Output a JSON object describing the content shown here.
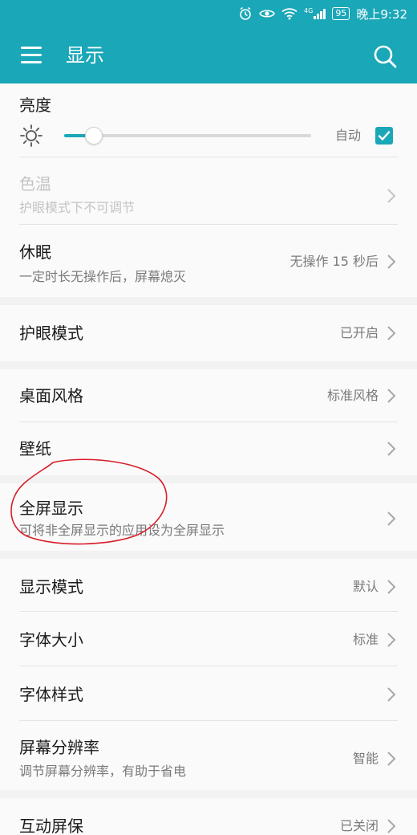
{
  "status_bar": {
    "network": "4G",
    "battery": "95",
    "time": "晚上9:32"
  },
  "app_bar": {
    "title": "显示"
  },
  "brightness": {
    "title": "亮度",
    "auto_label": "自动",
    "level": 0.12,
    "auto_checked": true
  },
  "color_temp": {
    "title": "色温",
    "subtitle": "护眼模式下不可调节"
  },
  "sleep": {
    "title": "休眠",
    "subtitle": "一定时长无操作后，屏幕熄灭",
    "value": "无操作 15 秒后"
  },
  "eye_comfort": {
    "title": "护眼模式",
    "value": "已开启"
  },
  "home_style": {
    "title": "桌面风格",
    "value": "标准风格"
  },
  "wallpaper": {
    "title": "壁纸"
  },
  "fullscreen": {
    "title": "全屏显示",
    "subtitle": "可将非全屏显示的应用设为全屏显示"
  },
  "display_mode": {
    "title": "显示模式",
    "value": "默认"
  },
  "font_size": {
    "title": "字体大小",
    "value": "标准"
  },
  "font_style": {
    "title": "字体样式"
  },
  "resolution": {
    "title": "屏幕分辨率",
    "subtitle": "调节屏幕分辨率，有助于省电",
    "value": "智能"
  },
  "screensaver": {
    "title": "互动屏保",
    "value": "已关闭"
  },
  "colors": {
    "accent": "#1aa7b8",
    "annotation": "#d81e2a"
  }
}
